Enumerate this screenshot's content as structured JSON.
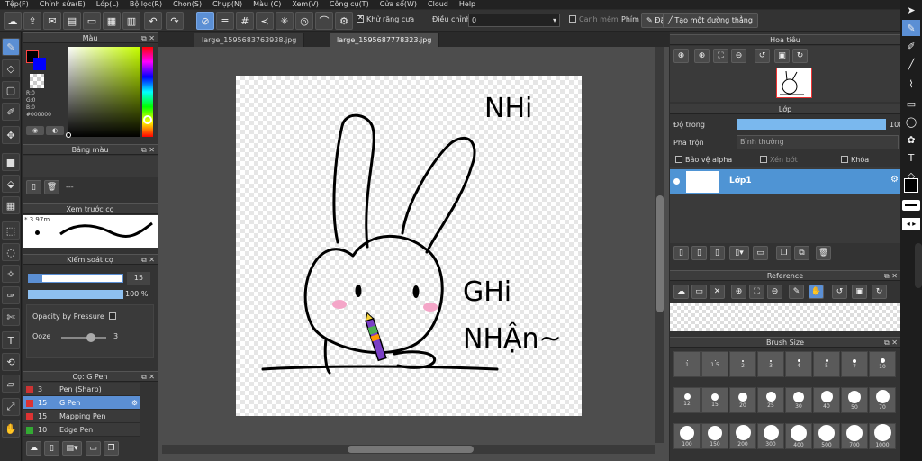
{
  "menu": [
    "Tệp(F)",
    "Chỉnh sửa(E)",
    "Lớp(L)",
    "Bộ lọc(R)",
    "Chọn(S)",
    "Chụp(N)",
    "Màu (C)",
    "Xem(V)",
    "Công cụ(T)",
    "Cửa sổ(W)",
    "Cloud",
    "Help"
  ],
  "toolbar": {
    "antialias_label": "Khử răng cưa",
    "adjust_label": "Điều chỉnh",
    "adjust_value": "0",
    "edge_soften_label": "Canh mềm",
    "key_label": "Phím",
    "reset_label": "Đặt lại",
    "straight_line_label": "Tạo một đường thẳng"
  },
  "tabs": [
    "large_1595683763938.jpg",
    "large_1595687778323.jpg"
  ],
  "left": {
    "color_title": "Màu",
    "color_r": "R:0",
    "color_g": "G:0",
    "color_b": "B:0",
    "color_hex": "#000000",
    "palette_title": "Bảng màu",
    "palette_value": "---",
    "preview_title": "Xem trước cọ",
    "preview_size": "3.97m",
    "brush_control_title": "Kiểm soát cọ",
    "size_value": "15",
    "opacity_value": "100 %",
    "opacity_by_pressure_label": "Opacity by Pressure",
    "ooze_label": "Ooze",
    "ooze_value": "3",
    "pen_title": "Cọ: G Pen",
    "pens": [
      {
        "size": "3",
        "name": "Pen (Sharp)",
        "color": "#cc3333"
      },
      {
        "size": "15",
        "name": "G Pen",
        "color": "#dd3333"
      },
      {
        "size": "15",
        "name": "Mapping Pen",
        "color": "#dd3333"
      },
      {
        "size": "10",
        "name": "Edge Pen",
        "color": "#33aa33"
      }
    ]
  },
  "right": {
    "navigator_title": "Hoa tiêu",
    "layer_title": "Lớp",
    "opacity_label": "Độ trong",
    "opacity_value": "100",
    "blend_label": "Pha trộn",
    "blend_value": "Bình thường",
    "protect_alpha_label": "Bảo vệ alpha",
    "clip_label": "Xén bớt",
    "lock_label": "Khóa",
    "layer_name": "Lớp1",
    "reference_title": "Reference",
    "brush_size_title": "Brush Size",
    "brush_sizes_row1": [
      "1",
      "1.5",
      "2",
      "3",
      "4",
      "5",
      "7",
      "10"
    ],
    "brush_sizes_row2": [
      "12",
      "15",
      "20",
      "25",
      "30",
      "40",
      "50",
      "70"
    ],
    "brush_sizes_row3": [
      "100",
      "150",
      "200",
      "300",
      "400",
      "500",
      "700",
      "1000"
    ]
  },
  "canvas": {
    "text_nhi": "NHi",
    "text_ghi": "GHi",
    "text_nhan": "NHẬn~"
  },
  "colors": {
    "accent": "#5b8fd4",
    "foreground": "#000000",
    "background": "#0000ff"
  }
}
